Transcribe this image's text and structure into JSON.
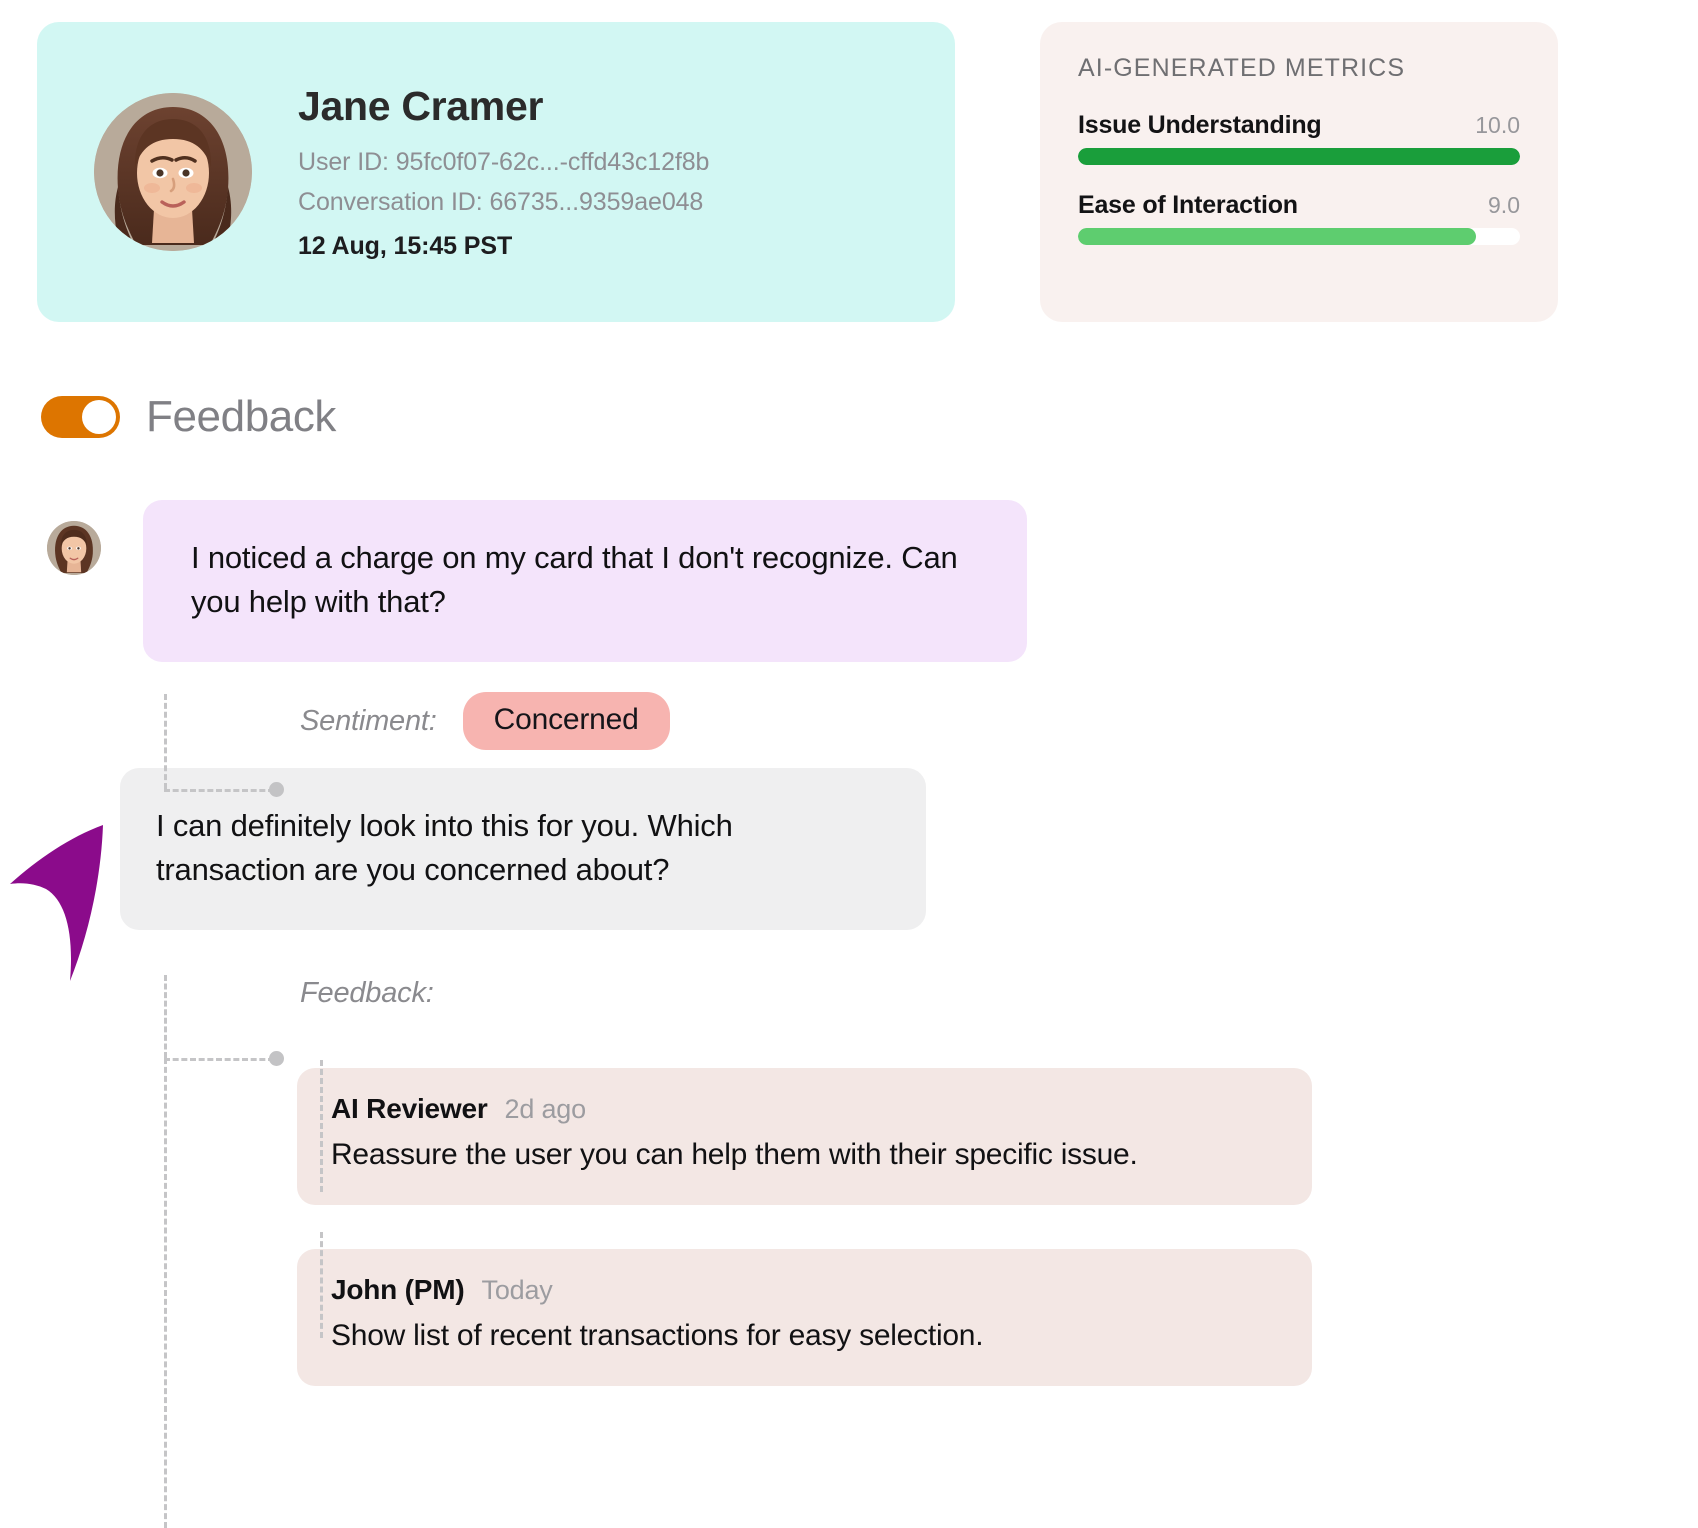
{
  "profile": {
    "name": "Jane Cramer",
    "user_id_line": "User ID: 95fc0f07-62c...-cffd43c12f8b",
    "conversation_id_line": "Conversation ID: 66735...9359ae048",
    "timestamp": "12 Aug, 15:45 PST",
    "card_color": "#d2f7f3"
  },
  "metrics": {
    "title": "AI-GENERATED METRICS",
    "card_color": "#f9f1ef",
    "items": [
      {
        "label": "Issue Understanding",
        "value": "10.0",
        "percent": 100,
        "color": "#1a9e3b"
      },
      {
        "label": "Ease of Interaction",
        "value": "9.0",
        "percent": 90,
        "color": "#5ecd6f"
      }
    ]
  },
  "feedback_toggle": {
    "label": "Feedback",
    "state": "on",
    "color": "#dd7500"
  },
  "conversation": [
    {
      "role": "user",
      "text": "I noticed a charge on my card that I don't recognize. Can you help with that?",
      "bubble_color": "#f4e4fb"
    },
    {
      "role": "agent",
      "text": "I can definitely look into this for you. Which transaction are you concerned about?",
      "bubble_color": "#efeff0"
    }
  ],
  "sentiment_annotation": {
    "label": "Sentiment:",
    "badge_text": "Concerned",
    "badge_color": "#f7b4b0"
  },
  "feedback_annotation": {
    "label": "Feedback:"
  },
  "feedback_items": [
    {
      "author": "AI Reviewer",
      "time": "2d ago",
      "text": "Reassure the user you can help them with their specific issue.",
      "card_color": "#f3e7e4"
    },
    {
      "author": "John (PM)",
      "time": "Today",
      "text": "Show list of recent transactions for easy selection.",
      "card_color": "#f3e7e4"
    }
  ],
  "cursor": {
    "icon": "cursor-arrow-icon",
    "color": "#8b0b8b"
  }
}
